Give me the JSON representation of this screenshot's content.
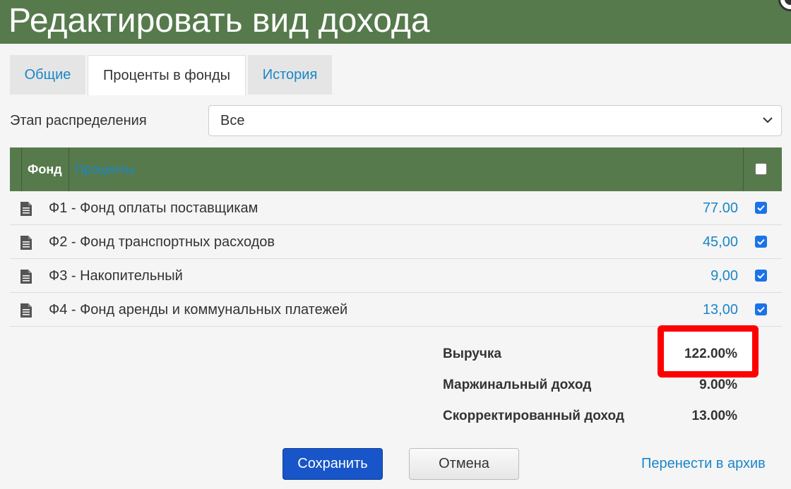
{
  "dialog": {
    "title": "Редактировать вид дохода"
  },
  "tabs": [
    {
      "label": "Общие",
      "active": false
    },
    {
      "label": "Проценты в фонды",
      "active": true
    },
    {
      "label": "История",
      "active": false
    }
  ],
  "stage": {
    "label": "Этап распределения",
    "value": "Все"
  },
  "table": {
    "headers": {
      "fund": "Фонд",
      "percent": "Проценты"
    },
    "select_all_checked": false,
    "rows": [
      {
        "name": "Ф1 - Фонд оплаты поставщикам",
        "percent": "77.00",
        "checked": true
      },
      {
        "name": "Ф2 - Фонд транспортных расходов",
        "percent": "45,00",
        "checked": true
      },
      {
        "name": "Ф3 - Накопительный",
        "percent": "9,00",
        "checked": true
      },
      {
        "name": "Ф4 - Фонд аренды и коммунальных платежей",
        "percent": "13,00",
        "checked": true
      }
    ]
  },
  "summary": [
    {
      "label": "Выручка",
      "value": "122.00%",
      "highlighted": true
    },
    {
      "label": "Маржинальный доход",
      "value": "9.00%",
      "highlighted": false
    },
    {
      "label": "Скорректированный доход",
      "value": "13.00%",
      "highlighted": false
    }
  ],
  "buttons": {
    "save": "Сохранить",
    "cancel": "Отмена",
    "archive": "Перенести в архив"
  },
  "colors": {
    "header_green": "#567a4c",
    "link_blue": "#1a86c8",
    "primary_button": "#1755c8",
    "highlight_red": "#ff0000"
  },
  "icons": {
    "row_icon": "document-icon",
    "select_arrow": "chevron-down-icon",
    "close": "close-icon"
  }
}
